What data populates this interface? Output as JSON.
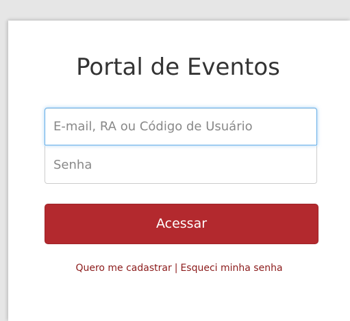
{
  "card": {
    "title": "Portal de Eventos",
    "login_field": {
      "placeholder": "E-mail, RA ou Código de Usuário",
      "value": ""
    },
    "password_field": {
      "placeholder": "Senha",
      "value": ""
    },
    "submit_label": "Acessar",
    "register_link": "Quero me cadastrar",
    "separator": "|",
    "forgot_link": "Esqueci minha senha"
  },
  "colors": {
    "button_bg": "#b3292e",
    "link": "#8b1a1a",
    "focus_border": "#66afe9"
  }
}
